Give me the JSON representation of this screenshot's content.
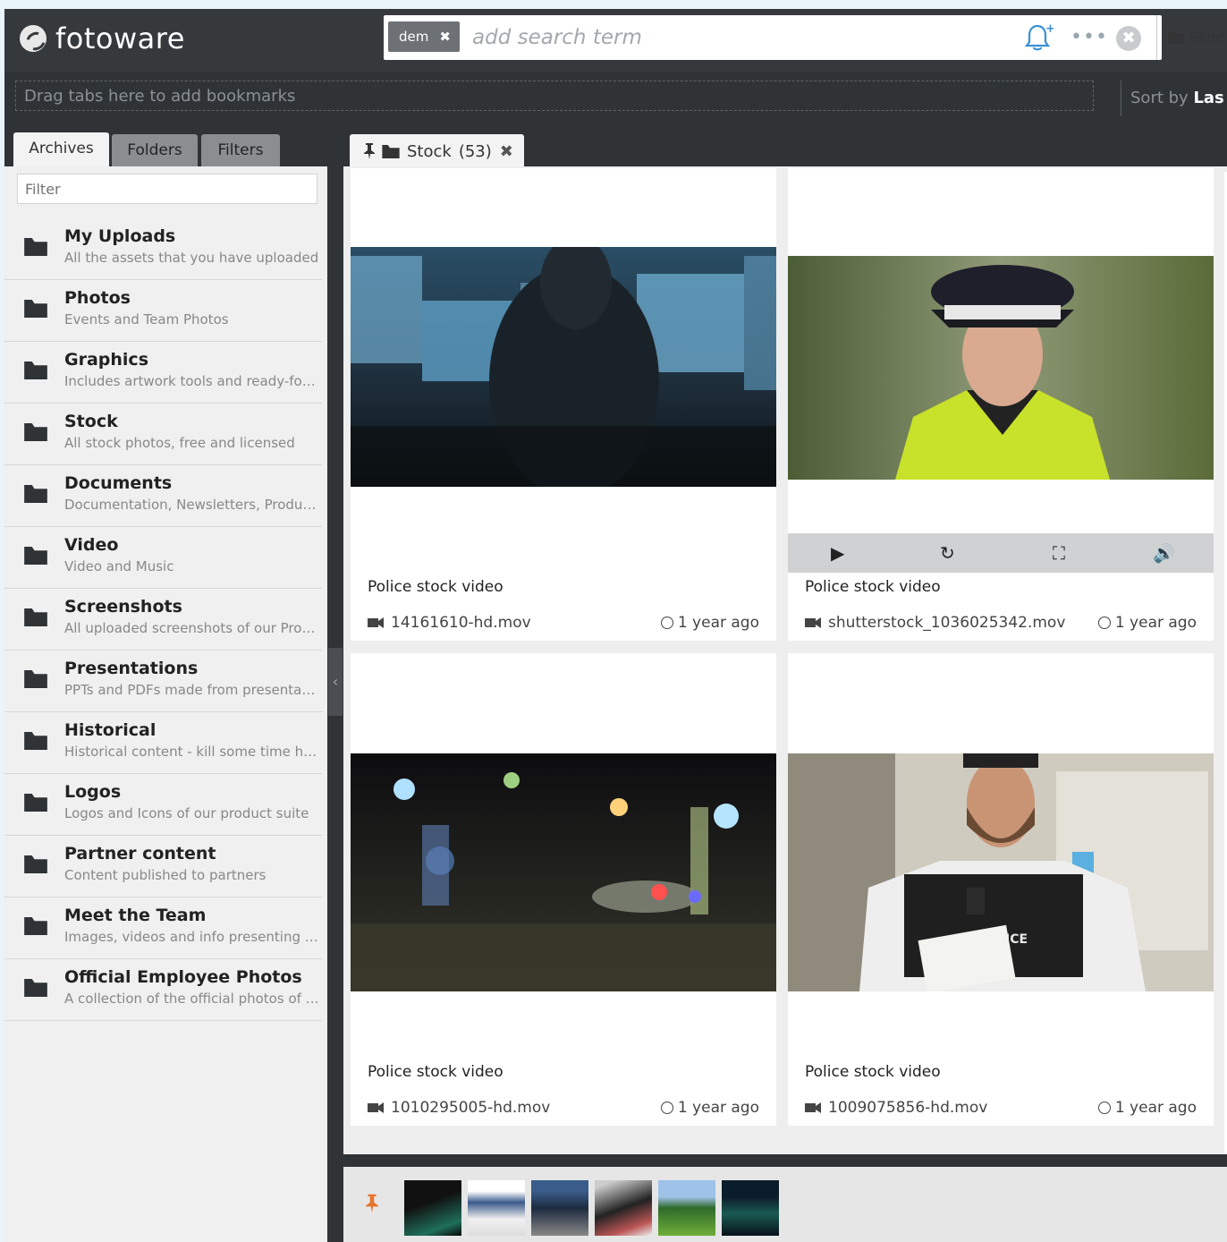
{
  "brand": {
    "name": "fotoware"
  },
  "search": {
    "chip": "dem",
    "chip_remove": "✖",
    "placeholder": "add search term",
    "more": "•••",
    "clear": "✖",
    "scope": "Stoc"
  },
  "bookmarks": {
    "dropzone": "Drag tabs here to add bookmarks",
    "sort_label": "Sort by",
    "sort_value": "Las"
  },
  "left_tabs": [
    {
      "label": "Archives"
    },
    {
      "label": "Folders"
    },
    {
      "label": "Filters"
    }
  ],
  "filter_placeholder": "Filter",
  "archives": [
    {
      "name": "My Uploads",
      "desc": "All the assets that you have uploaded"
    },
    {
      "name": "Photos",
      "desc": "Events and Team Photos"
    },
    {
      "name": "Graphics",
      "desc": "Includes artwork tools and ready-for-use graphics"
    },
    {
      "name": "Stock",
      "desc": "All stock photos, free and licensed"
    },
    {
      "name": "Documents",
      "desc": "Documentation, Newsletters, Product sheets"
    },
    {
      "name": "Video",
      "desc": "Video and Music"
    },
    {
      "name": "Screenshots",
      "desc": "All uploaded screenshots of our Products"
    },
    {
      "name": "Presentations",
      "desc": "PPTs and PDFs made from presentations"
    },
    {
      "name": "Historical",
      "desc": "Historical content - kill some time here"
    },
    {
      "name": "Logos",
      "desc": "Logos and Icons of our product suite"
    },
    {
      "name": "Partner content",
      "desc": "Content published to partners"
    },
    {
      "name": "Meet the Team",
      "desc": "Images, videos and info presenting the team"
    },
    {
      "name": "Official Employee Photos",
      "desc": "A collection of the official photos of employees"
    }
  ],
  "main_tab": {
    "label": "Stock",
    "count": "(53)",
    "close": "✖"
  },
  "cards": [
    {
      "title": "Police stock video",
      "file": "14161610-hd.mov",
      "time": "1 year ago"
    },
    {
      "title": "Police stock video",
      "file": "shutterstock_1036025342.mov",
      "time": "1 year ago"
    },
    {
      "title": "Police stock video",
      "file": "1010295005-hd.mov",
      "time": "1 year ago"
    },
    {
      "title": "Police stock video",
      "file": "1009075856-hd.mov",
      "time": "1 year ago"
    }
  ],
  "overlay_text": "POLICE",
  "colors": {
    "pin": "#e8742c",
    "topbar": "#36393c",
    "panel": "#f0f0f0"
  }
}
